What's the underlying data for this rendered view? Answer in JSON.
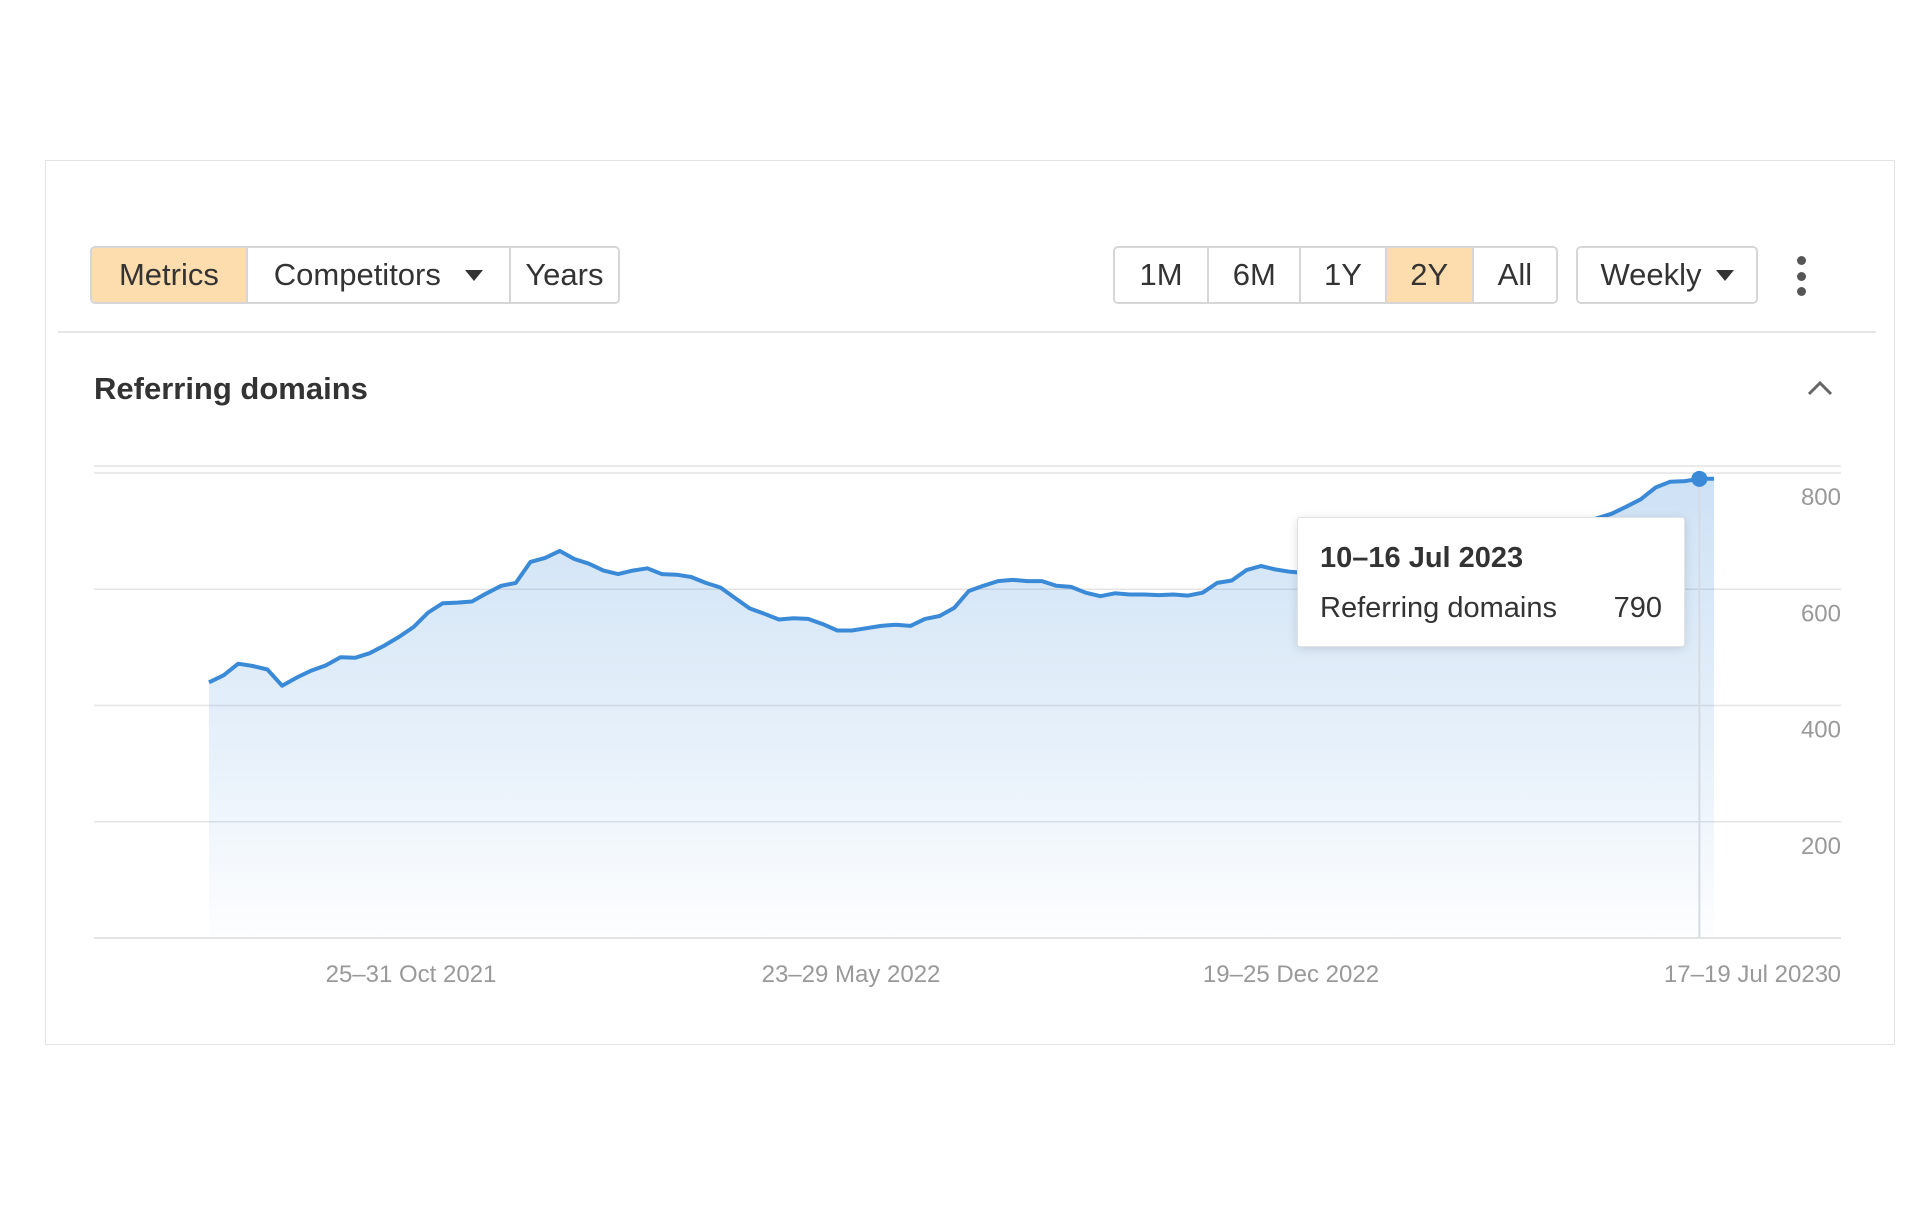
{
  "toolbar": {
    "view_tabs": [
      {
        "label": "Metrics",
        "active": true
      },
      {
        "label": "Competitors",
        "active": false,
        "dropdown": true
      },
      {
        "label": "Years",
        "active": false
      }
    ],
    "range_tabs": [
      {
        "label": "1M",
        "active": false
      },
      {
        "label": "6M",
        "active": false
      },
      {
        "label": "1Y",
        "active": false
      },
      {
        "label": "2Y",
        "active": true
      },
      {
        "label": "All",
        "active": false
      }
    ],
    "interval": {
      "label": "Weekly"
    },
    "more_icon": "kebab-vertical-icon"
  },
  "section": {
    "title": "Referring domains",
    "collapse_icon": "chevron-up-icon"
  },
  "colors": {
    "line": "#3a8ad8",
    "active_tab": "#fddcae",
    "grid": "#e4e4e4",
    "axis_text": "#999999"
  },
  "tooltip": {
    "date": "10–16 Jul 2023",
    "series": "Referring domains",
    "value": "790"
  },
  "chart_data": {
    "type": "area",
    "title": "Referring domains",
    "y_axis_position": "right",
    "ylim": [
      0,
      800
    ],
    "y_ticks": [
      "0",
      "200",
      "400",
      "600",
      "800"
    ],
    "x_ticks": [
      "25–31 Oct 2021",
      "23–29 May 2022",
      "19–25 Dec 2022",
      "17–19 Jul 2023"
    ],
    "x_range_weeks": [
      0,
      103
    ],
    "grid": true,
    "series": [
      {
        "name": "Referring domains",
        "x_week": [
          0,
          1,
          2,
          3,
          4,
          5,
          6,
          7,
          8,
          9,
          10,
          11,
          12,
          13,
          14,
          15,
          16,
          17,
          18,
          19,
          20,
          21,
          22,
          23,
          24,
          25,
          26,
          27,
          28,
          29,
          30,
          31,
          32,
          33,
          34,
          35,
          36,
          37,
          38,
          39,
          40,
          41,
          42,
          43,
          44,
          45,
          46,
          47,
          48,
          49,
          50,
          51,
          52,
          53,
          54,
          55,
          56,
          57,
          58,
          59,
          60,
          61,
          62,
          63,
          64,
          65,
          66,
          67,
          68,
          69,
          70,
          71,
          72,
          73,
          74,
          75,
          76,
          77,
          78,
          79,
          80,
          81,
          82,
          83,
          84,
          85,
          86,
          87,
          88,
          89,
          90,
          91,
          92,
          93,
          94,
          95,
          96,
          97,
          98,
          99,
          100,
          101,
          102,
          103
        ],
        "values": [
          440,
          452,
          472,
          468,
          462,
          434,
          448,
          460,
          469,
          483,
          482,
          490,
          503,
          518,
          535,
          560,
          576,
          577,
          579,
          593,
          606,
          611,
          647,
          654,
          666,
          652,
          644,
          632,
          626,
          632,
          636,
          626,
          625,
          621,
          611,
          603,
          585,
          567,
          558,
          548,
          550,
          549,
          540,
          529,
          529,
          533,
          537,
          539,
          537,
          549,
          554,
          568,
          597,
          606,
          614,
          616,
          614,
          614,
          606,
          604,
          594,
          588,
          593,
          591,
          591,
          590,
          591,
          589,
          594,
          611,
          615,
          633,
          640,
          634,
          630,
          628,
          631,
          634,
          640,
          645,
          648,
          654,
          658,
          662,
          665,
          669,
          673,
          677,
          681,
          686,
          690,
          695,
          702,
          708,
          715,
          722,
          730,
          742,
          755,
          775,
          785,
          786,
          790,
          790
        ],
        "fill": "gradient"
      }
    ],
    "highlighted_point": {
      "label": "10–16 Jul 2023",
      "value": 790
    }
  }
}
